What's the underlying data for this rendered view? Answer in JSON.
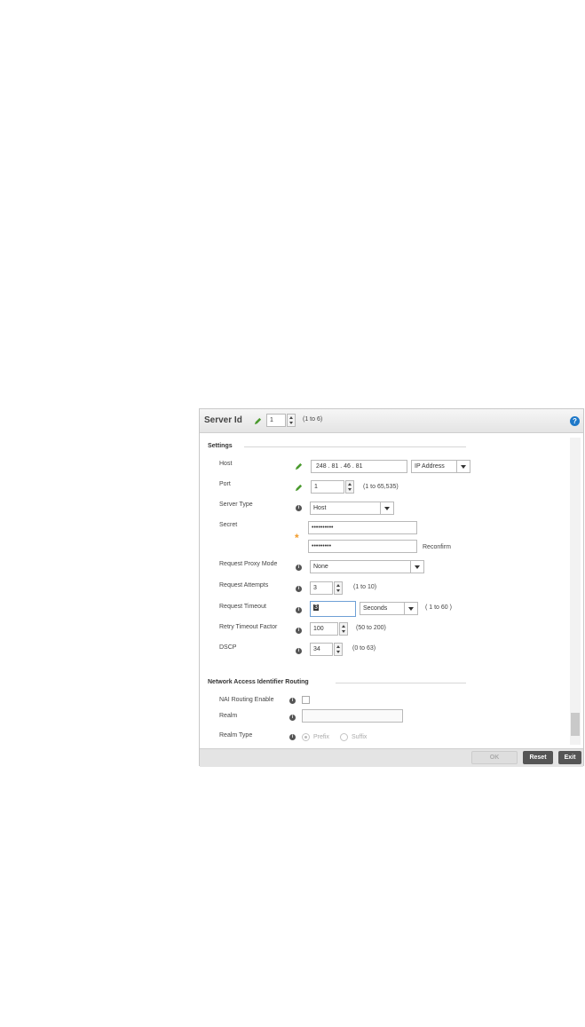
{
  "header": {
    "title": "Server Id",
    "server_id_value": "1",
    "server_id_range": "(1 to 6)"
  },
  "settings": {
    "section_title": "Settings",
    "host": {
      "label": "Host",
      "value": "248 . 81 . 46 . 81",
      "type_selected": "IP Address"
    },
    "port": {
      "label": "Port",
      "value": "1",
      "range": "(1 to 65,535)"
    },
    "server_type": {
      "label": "Server Type",
      "selected": "Host"
    },
    "secret": {
      "label": "Secret",
      "value": "••••••••••",
      "confirm_value": "•••••••••",
      "reconfirm_label": "Reconfirm"
    },
    "request_proxy_mode": {
      "label": "Request Proxy Mode",
      "selected": "None"
    },
    "request_attempts": {
      "label": "Request Attempts",
      "value": "3",
      "range": "(1 to 10)"
    },
    "request_timeout": {
      "label": "Request Timeout",
      "value": "3",
      "unit_selected": "Seconds",
      "range": "( 1 to 60 )"
    },
    "retry_timeout_factor": {
      "label": "Retry Timeout Factor",
      "value": "100",
      "range": "(50 to 200)"
    },
    "dscp": {
      "label": "DSCP",
      "value": "34",
      "range": "(0 to 63)"
    }
  },
  "nai": {
    "section_title": "Network Access Identifier Routing",
    "routing_enable": {
      "label": "NAI Routing Enable",
      "checked": false
    },
    "realm": {
      "label": "Realm",
      "value": ""
    },
    "realm_type": {
      "label": "Realm Type",
      "options": [
        "Prefix",
        "Suffix"
      ],
      "selected": "Prefix"
    }
  },
  "footer": {
    "ok_label": "OK",
    "reset_label": "Reset",
    "exit_label": "Exit"
  },
  "icons": {
    "edit": "pencil-icon",
    "info": "info-icon",
    "help": "question-icon",
    "required": "asterisk-icon"
  },
  "colors": {
    "pencil": "#4a9a2e",
    "required_star": "#f29b2a",
    "help_icon": "#1e78c8",
    "button_dark": "#555555"
  }
}
